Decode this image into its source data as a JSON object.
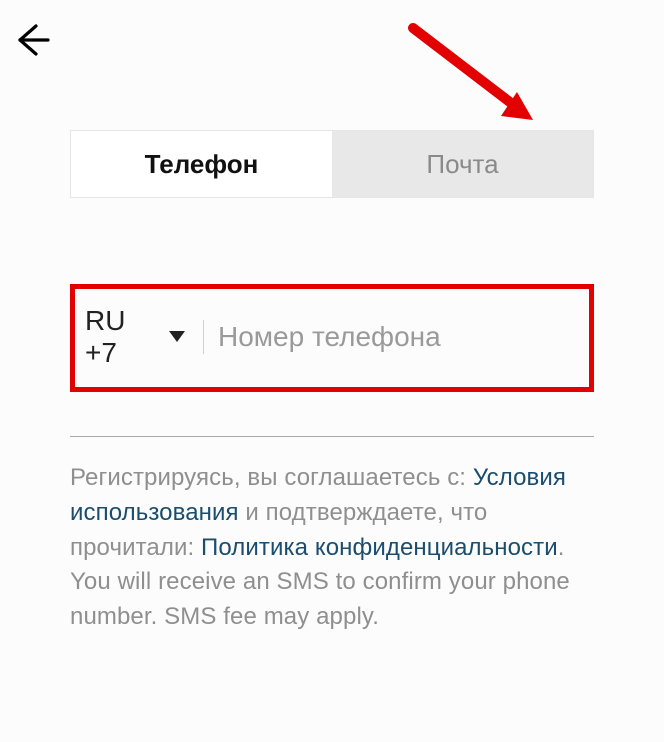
{
  "tabs": {
    "phone": "Телефон",
    "email": "Почта"
  },
  "phone_field": {
    "country_code": "RU +7",
    "placeholder": "Номер телефона"
  },
  "legal": {
    "part1": "Регистрируясь, вы соглашаетесь с: ",
    "terms": "Условия использования",
    "part2": " и подтверждаете, что прочитали: ",
    "privacy": "Политика конфиденциальности",
    "part3": ". You will receive an SMS to confirm your phone number. SMS fee may apply."
  }
}
